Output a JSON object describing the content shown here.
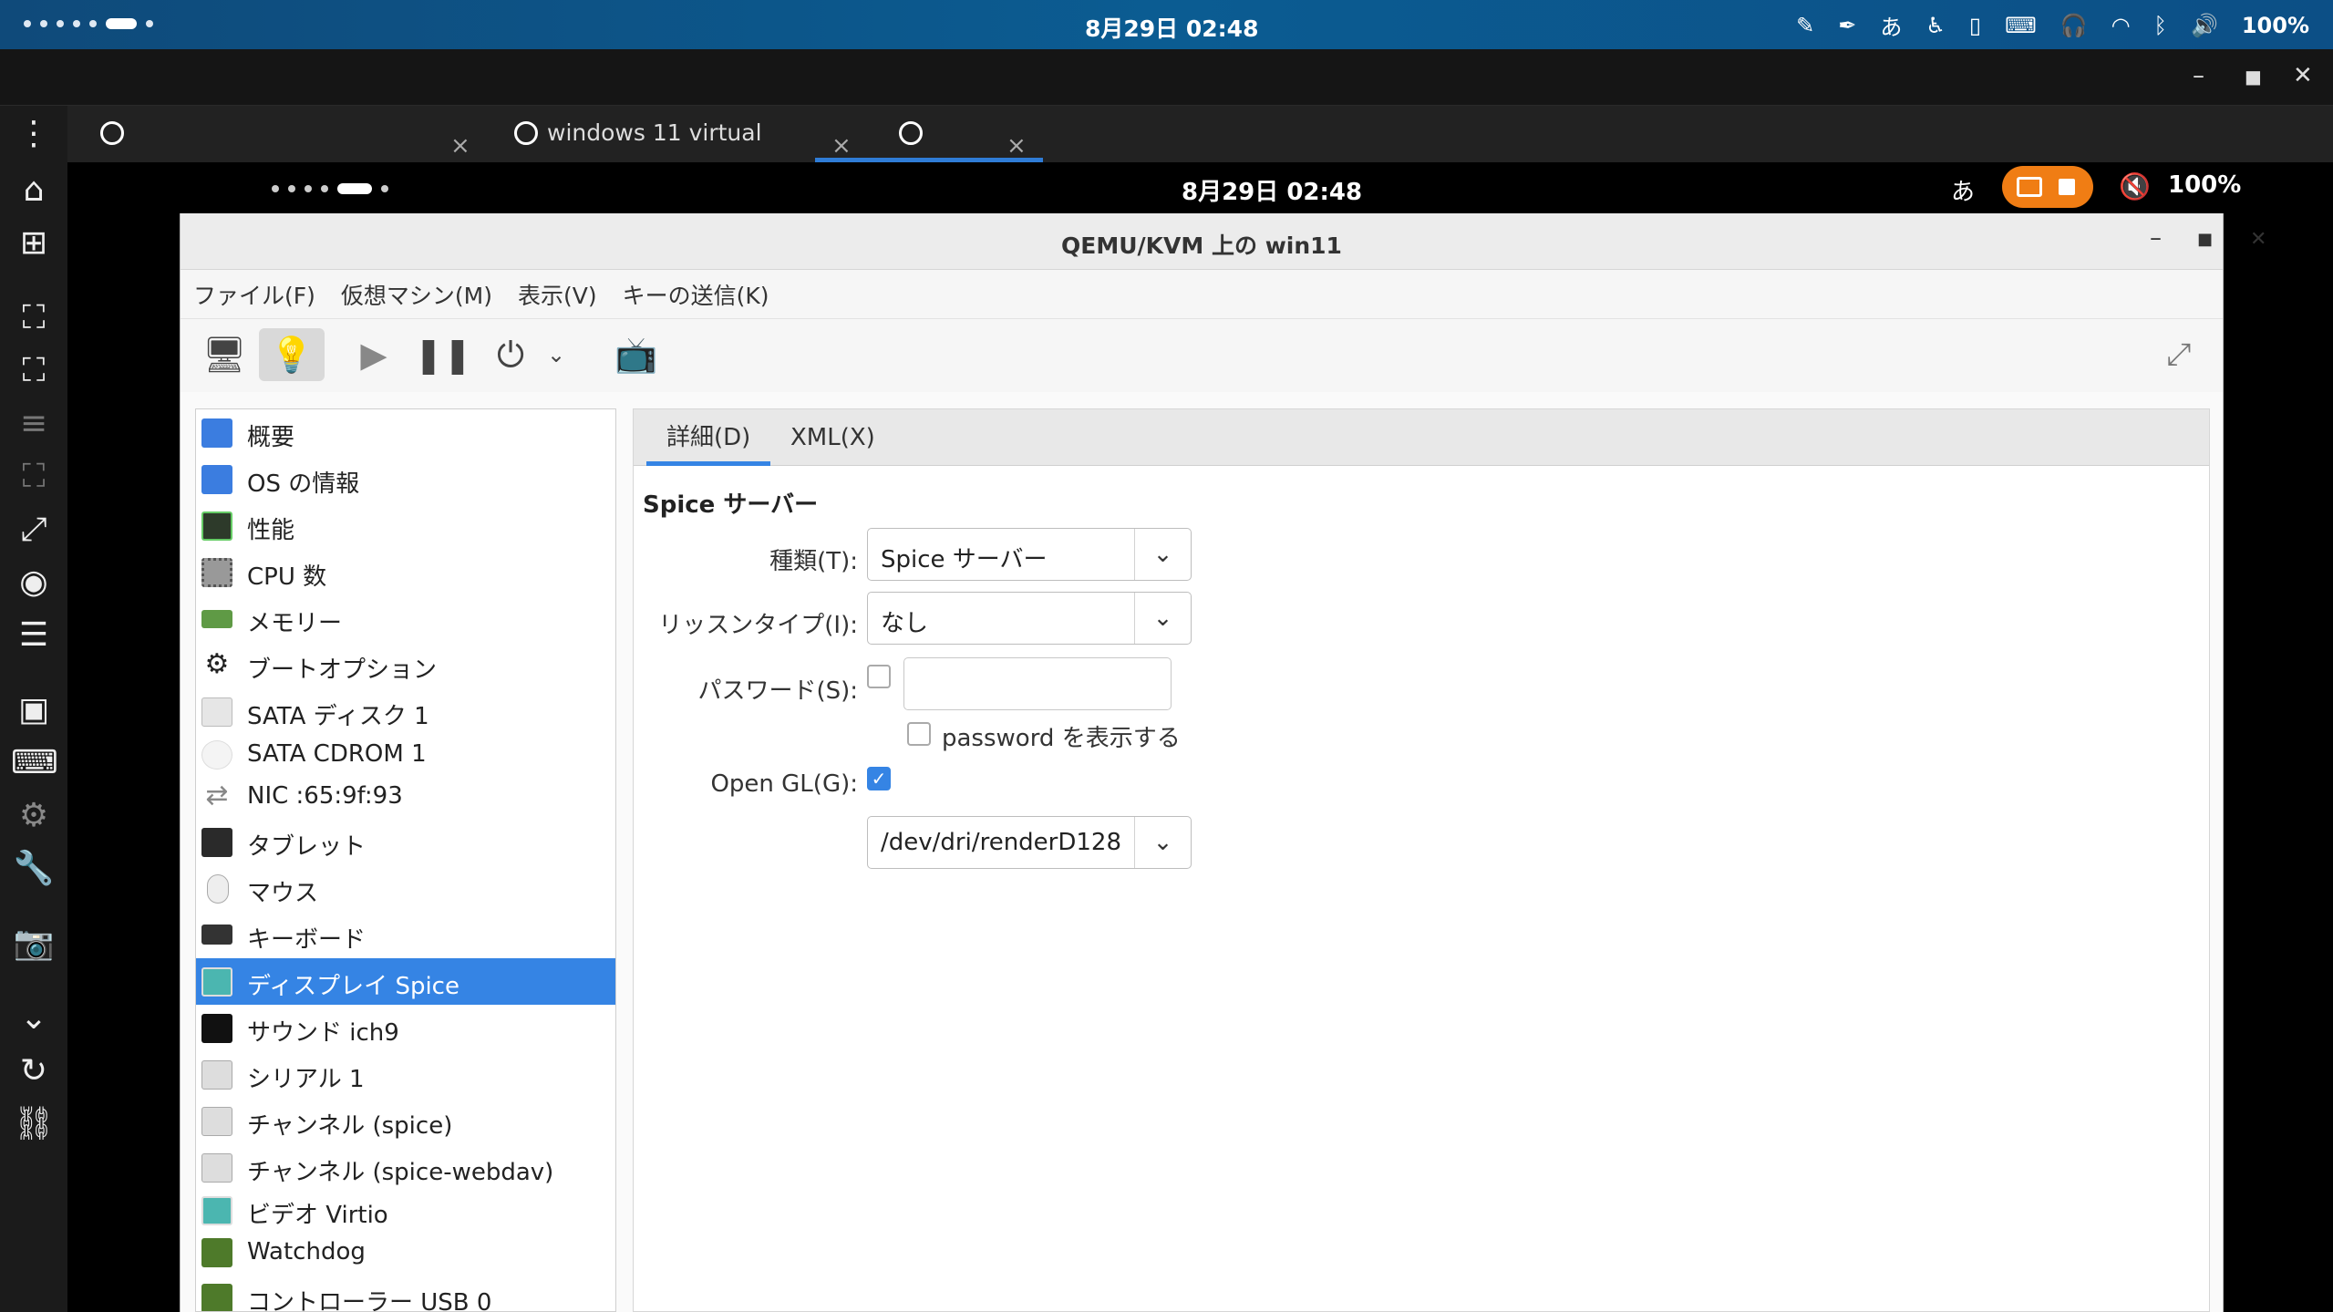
{
  "host_status": {
    "clock": "8月29日 02:48",
    "ime": "あ",
    "battery": "100%"
  },
  "tabs": [
    {
      "label": ""
    },
    {
      "label": "windows 11 virtual"
    },
    {
      "label": ""
    }
  ],
  "vm_status": {
    "clock": "8月29日 02:48",
    "ime": "あ",
    "battery": "100%"
  },
  "window": {
    "title": "QEMU/KVM 上の win11"
  },
  "menubar": [
    "ファイル(F)",
    "仮想マシン(M)",
    "表示(V)",
    "キーの送信(K)"
  ],
  "sidebar": [
    {
      "label": "概要",
      "icon": "monitor-icon"
    },
    {
      "label": "OS の情報",
      "icon": "monitor-icon"
    },
    {
      "label": "性能",
      "icon": "performance-icon"
    },
    {
      "label": "CPU 数",
      "icon": "cpu-icon"
    },
    {
      "label": "メモリー",
      "icon": "memory-icon"
    },
    {
      "label": "ブートオプション",
      "icon": "gear-icon"
    },
    {
      "label": "SATA ディスク 1",
      "icon": "disk-icon"
    },
    {
      "label": "SATA CDROM 1",
      "icon": "cdrom-icon"
    },
    {
      "label": "NIC :65:9f:93",
      "icon": "network-icon"
    },
    {
      "label": "タブレット",
      "icon": "tablet-icon"
    },
    {
      "label": "マウス",
      "icon": "mouse-icon"
    },
    {
      "label": "キーボード",
      "icon": "keyboard-icon"
    },
    {
      "label": "ディスプレイ Spice",
      "icon": "display-icon",
      "selected": true
    },
    {
      "label": "サウンド ich9",
      "icon": "sound-icon"
    },
    {
      "label": "シリアル 1",
      "icon": "serial-icon"
    },
    {
      "label": "チャンネル (spice)",
      "icon": "channel-icon"
    },
    {
      "label": "チャンネル (spice-webdav)",
      "icon": "channel-icon"
    },
    {
      "label": "ビデオ Virtio",
      "icon": "video-icon"
    },
    {
      "label": "Watchdog",
      "icon": "watchdog-icon"
    },
    {
      "label": "コントローラー USB 0",
      "icon": "controller-icon"
    }
  ],
  "detail": {
    "tabs": [
      "詳細(D)",
      "XML(X)"
    ],
    "section_title": "Spice サーバー",
    "type_label": "種類(T):",
    "type_value": "Spice サーバー",
    "listen_label": "リッスンタイプ(I):",
    "listen_value": "なし",
    "password_label": "パスワード(S):",
    "password_value": "",
    "show_password_label": "password を表示する",
    "opengl_label": "Open GL(G):",
    "opengl_checked": true,
    "render_node_value": "/dev/dri/renderD128"
  },
  "colors": {
    "accent": "#3584e4",
    "host_status_bg": "#0b5c92",
    "record_pill": "#f07d14"
  }
}
